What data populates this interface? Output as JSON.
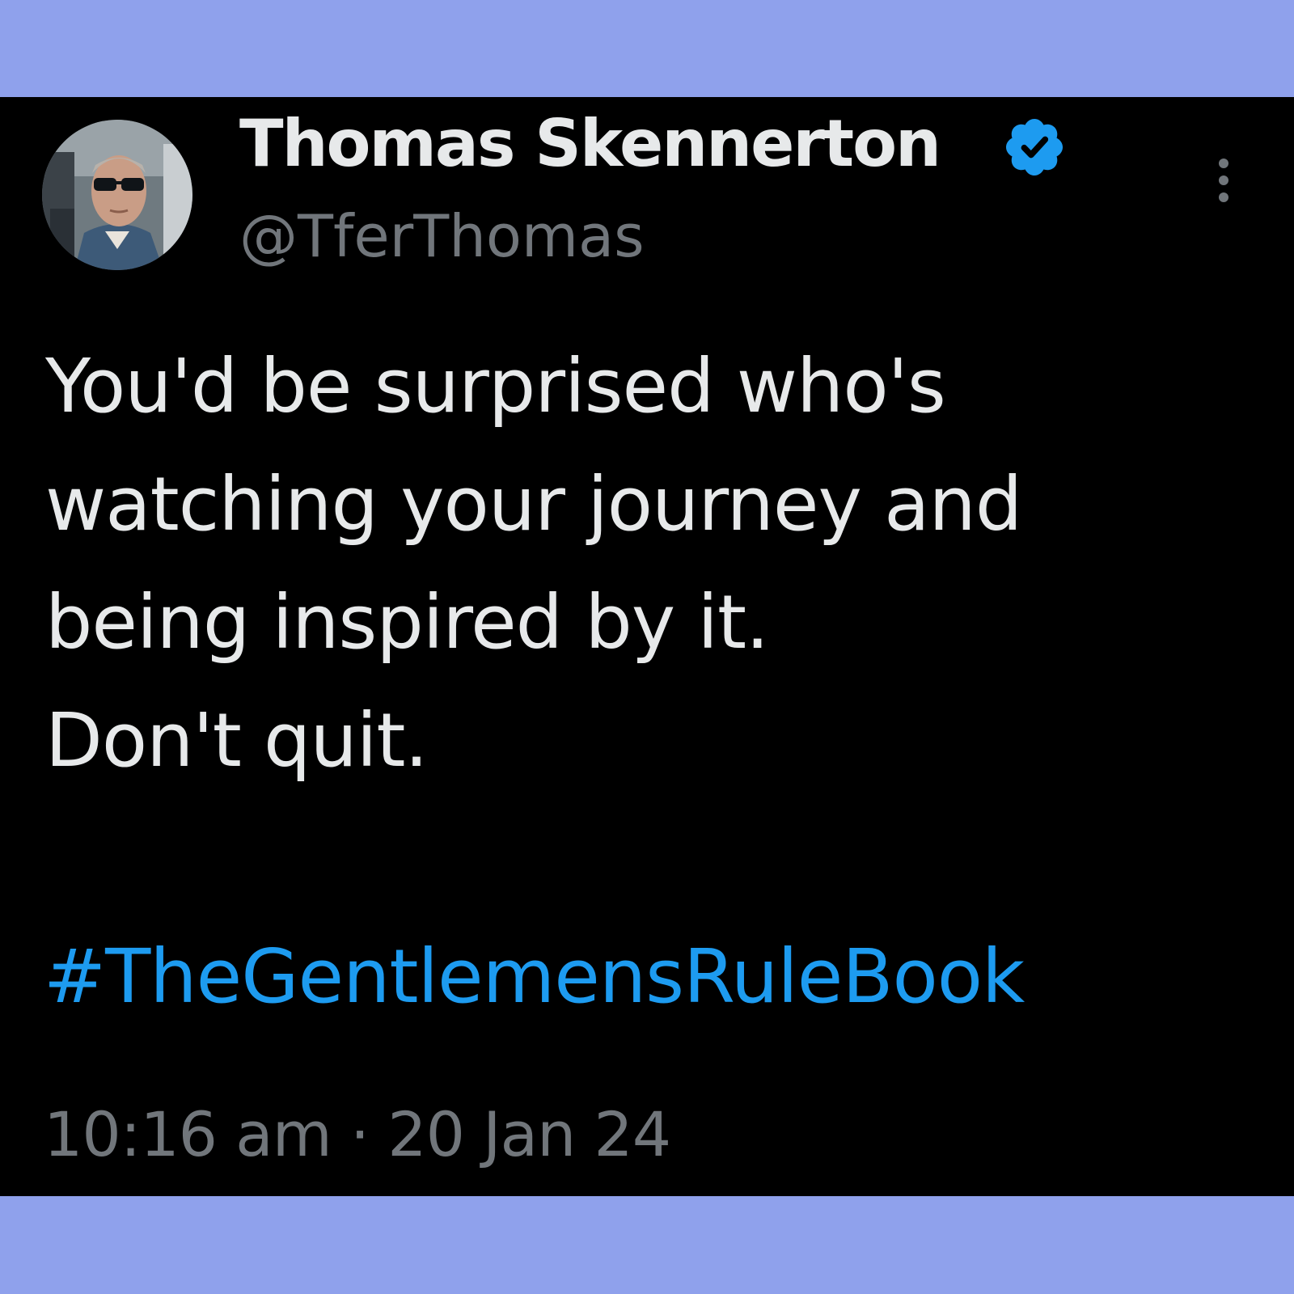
{
  "colors": {
    "frame_band": "#8fa1ec",
    "card_background": "#000000",
    "name_text": "#e7e9ea",
    "secondary_text": "#71767b",
    "body_text": "#e7e9ea",
    "link_blue": "#1d9bf0",
    "badge_blue": "#1d9bf0"
  },
  "author": {
    "avatar_icon": "profile-photo",
    "display_name": "Thomas Skennerton",
    "verified_icon": "verified-badge-icon",
    "handle": "@TferThomas"
  },
  "menu": {
    "icon": "more-vertical-icon"
  },
  "tweet": {
    "lines": [
      "You'd be surprised who's",
      "watching your journey and",
      "being inspired by it.",
      "Don't quit."
    ],
    "hashtag": "#TheGentlemensRuleBook",
    "timestamp": "10:16 am · 20 Jan 24"
  }
}
